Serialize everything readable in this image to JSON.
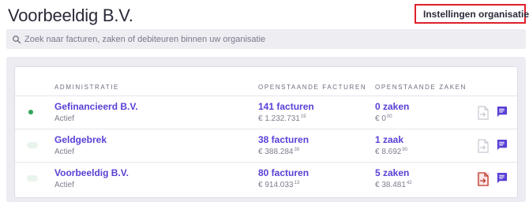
{
  "header": {
    "title": "Voorbeeldig B.V.",
    "settings_label": "Instellingen organisatie"
  },
  "search": {
    "placeholder": "Zoek naar facturen, zaken of debiteuren binnen uw organisatie"
  },
  "table": {
    "columns": {
      "administration": "ADMINISTRATIE",
      "open_invoices": "OPENSTAANDE FACTUREN",
      "open_cases": "OPENSTAANDE ZAKEN"
    },
    "rows": [
      {
        "name": "Gefinancieerd B.V.",
        "status": "Actief",
        "invoices": "141 facturen",
        "invoices_amount": "€ 1.232.731",
        "invoices_cents": "19",
        "cases": "0 zaken",
        "cases_amount": "€ 0",
        "cases_cents": "00"
      },
      {
        "name": "Geldgebrek",
        "status": "Actief",
        "invoices": "38 facturen",
        "invoices_amount": "€ 388.284",
        "invoices_cents": "39",
        "cases": "1 zaak",
        "cases_amount": "€ 8.692",
        "cases_cents": "90"
      },
      {
        "name": "Voorbeeldig B.V.",
        "status": "Actief",
        "invoices": "80 facturen",
        "invoices_amount": "€ 914.033",
        "invoices_cents": "13",
        "cases": "5 zaken",
        "cases_amount": "€ 38.481",
        "cases_cents": "42"
      }
    ]
  },
  "colors": {
    "accent": "#5a3fd6",
    "status_active": "#2fa55a",
    "highlight_border": "#e0202a",
    "active_doc_icon": "#c0392b"
  }
}
